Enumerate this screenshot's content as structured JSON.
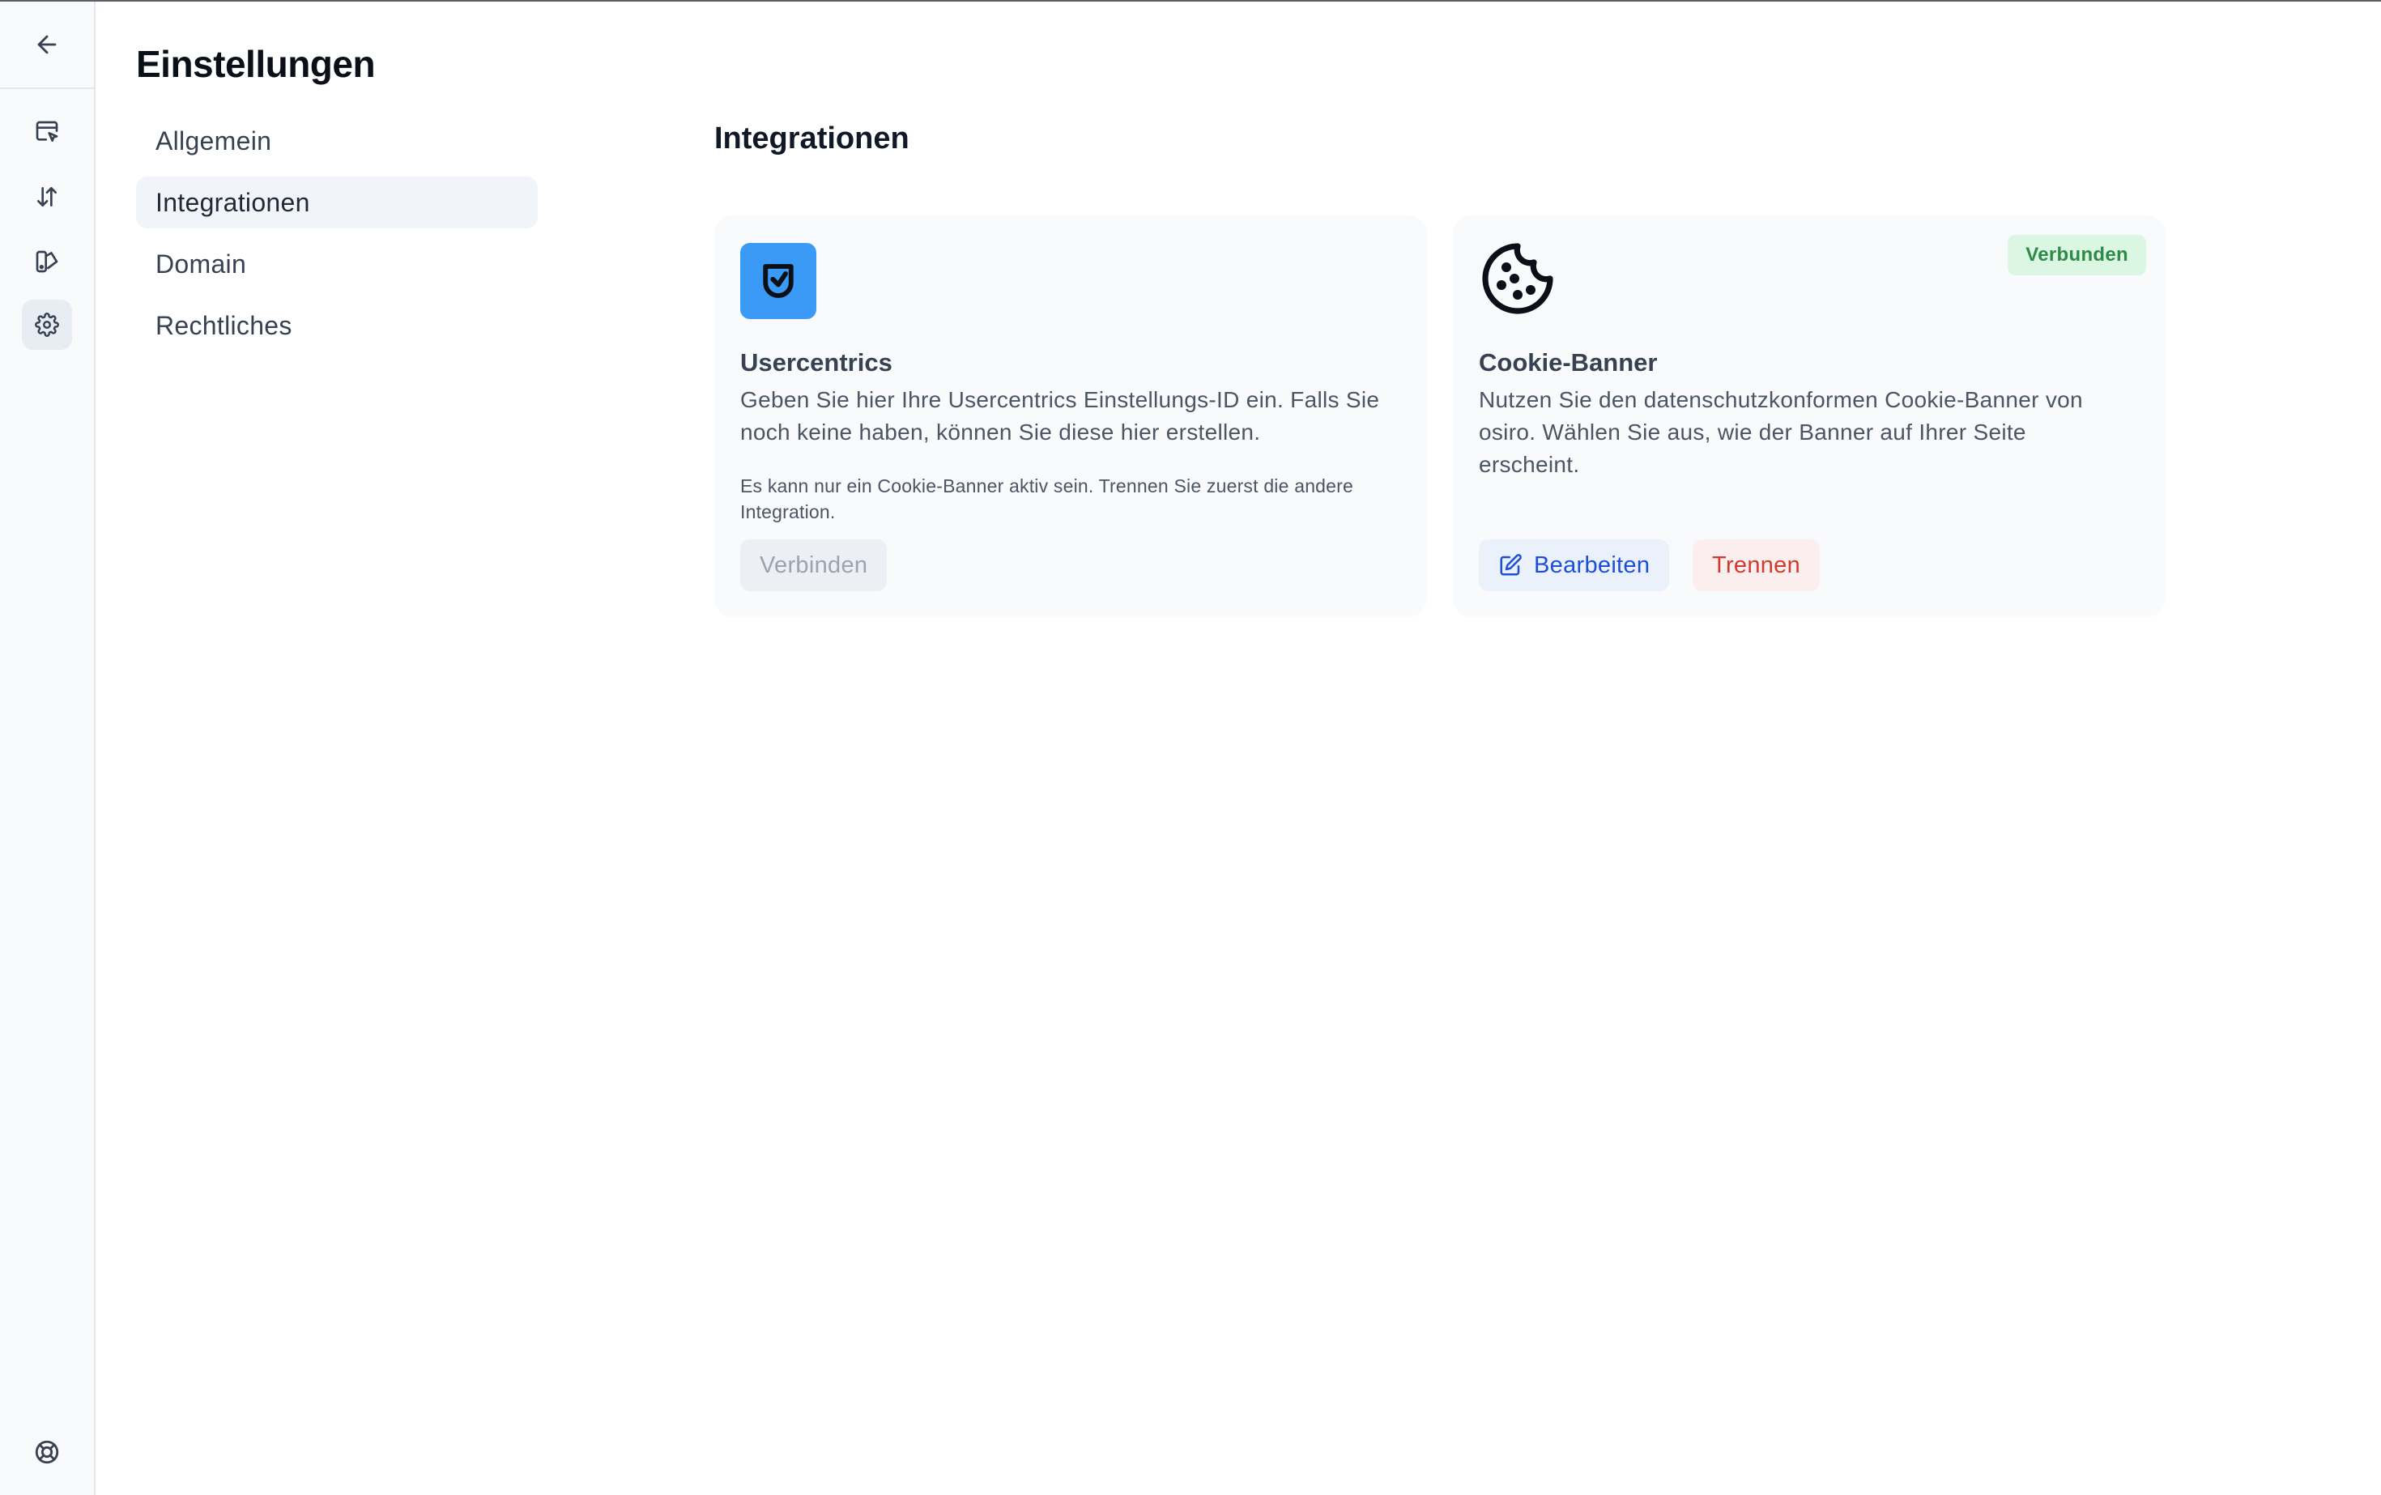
{
  "settings": {
    "title": "Einstellungen",
    "nav": [
      {
        "label": "Allgemein",
        "active": false
      },
      {
        "label": "Integrationen",
        "active": true
      },
      {
        "label": "Domain",
        "active": false
      },
      {
        "label": "Rechtliches",
        "active": false
      }
    ]
  },
  "rail": {
    "items": [
      {
        "icon": "arrow-left-icon"
      },
      {
        "icon": "browser-cursor-icon"
      },
      {
        "icon": "arrows-up-down-icon"
      },
      {
        "icon": "swatch-book-icon"
      },
      {
        "icon": "gear-icon",
        "active": true
      },
      {
        "icon": "lifebuoy-icon"
      }
    ]
  },
  "main": {
    "section_title": "Integrationen",
    "cards": [
      {
        "id": "usercentrics",
        "icon": "shield-check-icon",
        "title": "Usercentrics",
        "description": "Geben Sie hier Ihre Usercentrics Einstellungs-ID ein. Falls Sie noch keine haben, können Sie diese hier erstellen.",
        "note": "Es kann nur ein Cookie-Banner aktiv sein. Trennen Sie zuerst die andere Integration.",
        "connect_label": "Verbinden"
      },
      {
        "id": "cookie-banner",
        "icon": "cookie-icon",
        "title": "Cookie-Banner",
        "description": "Nutzen Sie den datenschutzkonformen Cookie-Banner von osiro. Wählen Sie aus, wie der Banner auf Ihrer Seite erscheint.",
        "status_badge": "Verbunden",
        "edit_label": "Bearbeiten",
        "disconnect_label": "Trennen"
      }
    ]
  },
  "colors": {
    "accent_blue": "#1d4ed8",
    "usercentrics_blue": "#3b9af5",
    "danger_red": "#d23b2c",
    "success_green": "#2f8a48"
  }
}
